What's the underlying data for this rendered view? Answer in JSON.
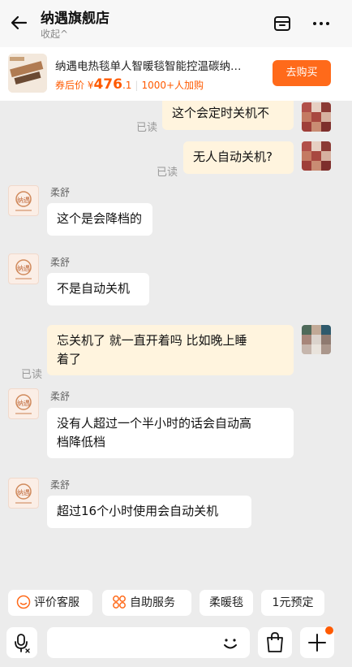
{
  "header": {
    "shop_name": "纳遇旗舰店",
    "collapse_label": "收起^"
  },
  "product": {
    "title": "纳遇电热毯单人智暖毯智能控温碳纳…",
    "price_prefix": "券后价 ¥",
    "price_int": "476",
    "price_dec": ".1",
    "buyers": "1000+人加购",
    "buy_button": "去购买"
  },
  "messages": [
    {
      "side": "right",
      "text": "这个会定时关机不",
      "read": "已读"
    },
    {
      "side": "right",
      "text": "无人自动关机?",
      "read": "已读"
    },
    {
      "side": "left",
      "sender": "柔舒",
      "text": "这个是会降档的"
    },
    {
      "side": "left",
      "sender": "柔舒",
      "text": "不是自动关机"
    },
    {
      "side": "right",
      "text_line1": "忘关机了 就一直开着吗 比如晚上睡",
      "text_line2": "着了",
      "read": "已读"
    },
    {
      "side": "left",
      "sender": "柔舒",
      "text_line1": "没有人超过一个半小时的话会自动高",
      "text_line2": "档降低档"
    },
    {
      "side": "left",
      "sender": "柔舒",
      "text": "超过16个小时使用会自动关机"
    }
  ],
  "quick_actions": [
    "评价客服",
    "自助服务",
    "柔暖毯",
    "1元预定"
  ],
  "input": {
    "placeholder": ""
  },
  "colors": {
    "accent": "#ff6a1a",
    "bubble_self": "#fff4de",
    "background": "#ececec"
  }
}
